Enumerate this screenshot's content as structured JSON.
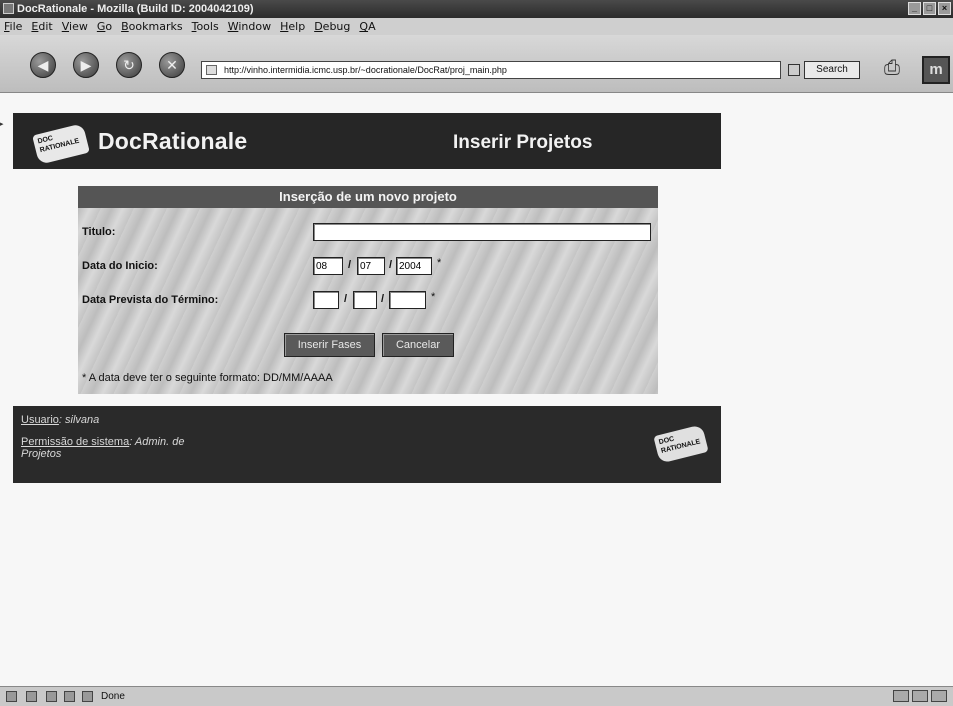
{
  "window": {
    "title": "DocRationale - Mozilla (Build ID: 2004042109)",
    "controls": [
      "_",
      "□",
      "×"
    ]
  },
  "menu": [
    "File",
    "Edit",
    "View",
    "Go",
    "Bookmarks",
    "Tools",
    "Window",
    "Help",
    "Debug",
    "QA"
  ],
  "toolbar": {
    "back_icon": "◀",
    "forward_icon": "▶",
    "reload_icon": "↻",
    "stop_icon": "✕",
    "url": "http://vinho.intermidia.icmc.usp.br/~docrationale/DocRat/proj_main.php",
    "search_label": "Search",
    "throbber_icon": "m"
  },
  "header": {
    "brand": "DocRationale",
    "page_title": "Inserir Projetos",
    "logo_text": "DOC RATIONALE"
  },
  "form": {
    "heading": "Inserção de um novo projeto",
    "title_label": "Titulo:",
    "title_value": "",
    "start_label": "Data do Inicio:",
    "start_day": "08",
    "start_month": "07",
    "start_year": "2004",
    "end_label": "Data Prevista do Término:",
    "end_day": "",
    "end_month": "",
    "end_year": "",
    "separator": "/",
    "required_mark": "*",
    "insert_button": "Inserir Fases",
    "cancel_button": "Cancelar",
    "note": "* A data deve ter o seguinte formato:   DD/MM/AAAA"
  },
  "footer": {
    "user_label": "Usuario",
    "user_value": ": silvana",
    "perm_label": "Permissão de sistema",
    "perm_value": ": Admin. de",
    "perm_value_2": "Projetos",
    "logo_text": "DOC RATIONALE"
  },
  "status": {
    "text": "Done"
  }
}
